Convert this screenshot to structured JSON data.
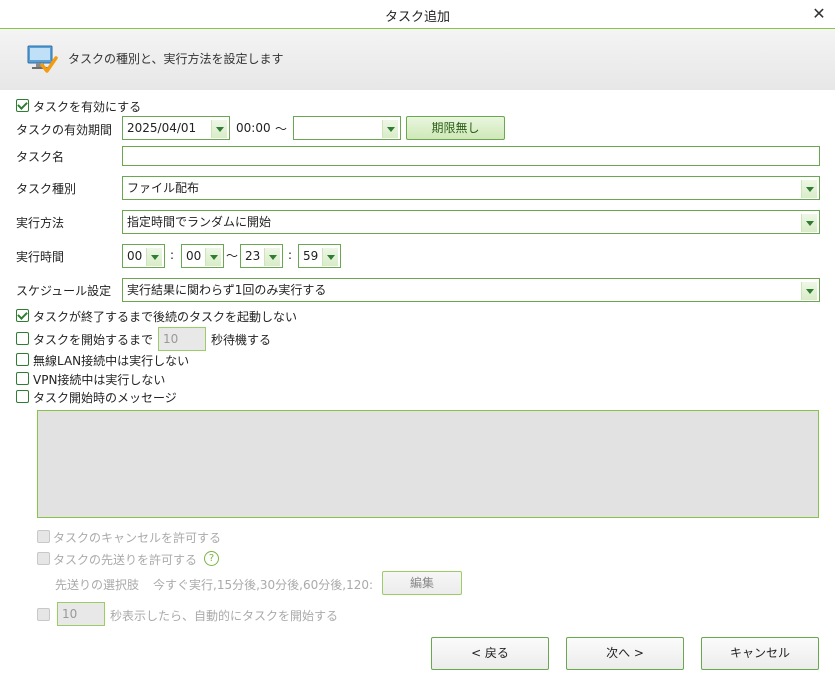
{
  "window": {
    "title": "タスク追加",
    "close_label": "✕"
  },
  "header": {
    "text": "タスクの種別と、実行方法を設定します"
  },
  "form": {
    "enable_task": {
      "label": "タスクを有効にする",
      "checked": true
    },
    "validity": {
      "label": "タスクの有効期間",
      "start_date": "2025/04/01",
      "start_time": "00:00",
      "separator": "〜",
      "end_date": "",
      "no_limit_button": "期限無し"
    },
    "task_name": {
      "label": "タスク名",
      "value": ""
    },
    "task_type": {
      "label": "タスク種別",
      "value": "ファイル配布"
    },
    "exec_method": {
      "label": "実行方法",
      "value": "指定時間でランダムに開始"
    },
    "exec_time": {
      "label": "実行時間",
      "start_hour": "00",
      "start_min": "00",
      "end_hour": "23",
      "end_min": "59",
      "colon": ":",
      "range_sep": "〜"
    },
    "schedule": {
      "label": "スケジュール設定",
      "value": "実行結果に関わらず1回のみ実行する"
    },
    "wait_until_done": {
      "label": "タスクが終了するまで後続のタスクを起動しない",
      "checked": true
    },
    "wait_before_start": {
      "label_pre": "タスクを開始するまで",
      "value": "10",
      "label_post": "秒待機する",
      "checked": false
    },
    "no_wireless": {
      "label": "無線LAN接続中は実行しない",
      "checked": false
    },
    "no_vpn": {
      "label": "VPN接続中は実行しない",
      "checked": false
    },
    "start_message": {
      "label": "タスク開始時のメッセージ",
      "checked": false,
      "value": ""
    },
    "allow_cancel": {
      "label": "タスクのキャンセルを許可する"
    },
    "allow_postpone": {
      "label": "タスクの先送りを許可する",
      "help": "?"
    },
    "postpone_options": {
      "label": "先送りの選択肢",
      "value": "今すぐ実行,15分後,30分後,60分後,120:",
      "edit_button": "編集"
    },
    "auto_start": {
      "value": "10",
      "label": "秒表示したら、自動的にタスクを開始する"
    }
  },
  "footer": {
    "back": "< 戻る",
    "next": "次へ >",
    "cancel": "キャンセル"
  },
  "colors": {
    "accent": "#8bc34a",
    "check": "#2e7d32"
  }
}
